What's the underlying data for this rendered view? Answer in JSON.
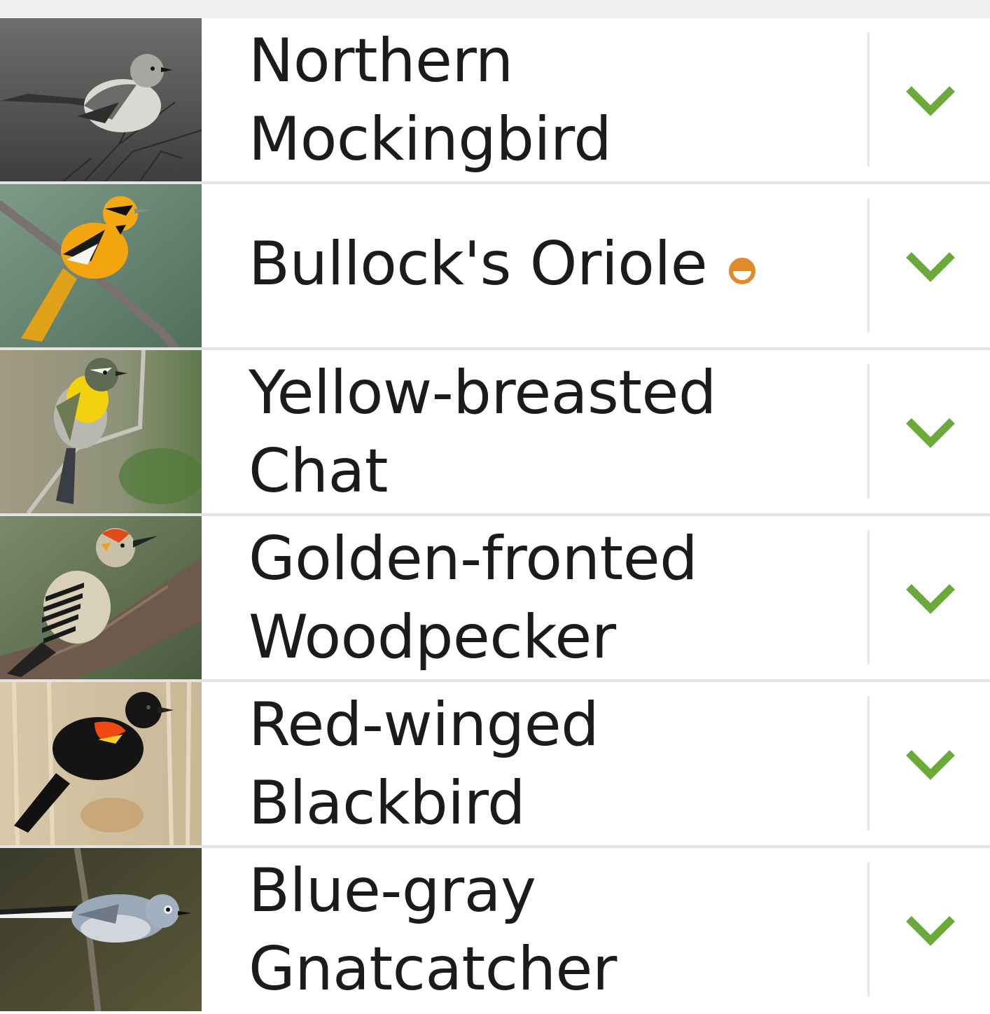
{
  "list": {
    "items": [
      {
        "name": "Northern Mockingbird",
        "line1": "Northern",
        "line2": "Mockingbird",
        "has_status_badge": false,
        "photo_icon": "northern-mockingbird-photo",
        "expand_icon": "chevron-down-icon"
      },
      {
        "name": "Bullock's Oriole",
        "line1": "Bullock's Oriole",
        "line2": "",
        "has_status_badge": true,
        "status_badge_icon": "half-filled-circle-icon",
        "photo_icon": "bullocks-oriole-photo",
        "expand_icon": "chevron-down-icon"
      },
      {
        "name": "Yellow-breasted Chat",
        "line1": "Yellow-breasted",
        "line2": "Chat",
        "has_status_badge": false,
        "photo_icon": "yellow-breasted-chat-photo",
        "expand_icon": "chevron-down-icon"
      },
      {
        "name": "Golden-fronted Woodpecker",
        "line1": "Golden-fronted",
        "line2": "Woodpecker",
        "has_status_badge": false,
        "photo_icon": "golden-fronted-woodpecker-photo",
        "expand_icon": "chevron-down-icon"
      },
      {
        "name": "Red-winged Blackbird",
        "line1": "Red-winged",
        "line2": "Blackbird",
        "has_status_badge": false,
        "photo_icon": "red-winged-blackbird-photo",
        "expand_icon": "chevron-down-icon"
      },
      {
        "name": "Blue-gray Gnatcatcher",
        "line1": "Blue-gray",
        "line2": "Gnatcatcher",
        "has_status_badge": false,
        "photo_icon": "blue-gray-gnatcatcher-photo",
        "expand_icon": "chevron-down-icon"
      }
    ]
  },
  "colors": {
    "chevron": "#6aaa3a",
    "status_badge": "#e08a2a",
    "divider": "#e3e3e3",
    "text": "#1b1b1b"
  }
}
